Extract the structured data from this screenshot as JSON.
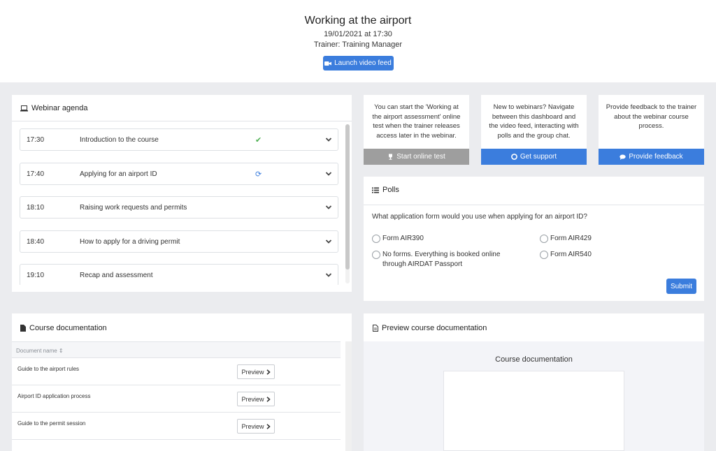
{
  "header": {
    "title": "Working at the airport",
    "date": "19/01/2021 at 17:30",
    "trainer": "Trainer: Training Manager",
    "launch_label": "Launch video feed"
  },
  "agenda": {
    "title": "Webinar agenda",
    "items": [
      {
        "time": "17:30",
        "topic": "Introduction to the course",
        "status": "✔"
      },
      {
        "time": "17:40",
        "topic": "Applying for an airport ID",
        "status": "⟳"
      },
      {
        "time": "18:10",
        "topic": "Raising work requests and permits",
        "status": ""
      },
      {
        "time": "18:40",
        "topic": "How to apply for a driving permit",
        "status": ""
      },
      {
        "time": "19:10",
        "topic": "Recap and assessment",
        "status": ""
      }
    ]
  },
  "info_cards": [
    {
      "text": "You can start the 'Working at the airport assessment' online test when the trainer releases access later in the webinar.",
      "action": "Start online test",
      "icon": "trophy-icon"
    },
    {
      "text": "New to webinars? Navigate between this dashboard and the video feed, interacting with polls and the group chat.",
      "action": "Get support",
      "icon": "lifebuoy-icon"
    },
    {
      "text": "Provide feedback to the trainer about the webinar course process.",
      "action": "Provide feedback",
      "icon": "comment-icon"
    }
  ],
  "polls": {
    "title": "Polls",
    "question": "What application form would you use when applying for an airport ID?",
    "options": [
      "Form AIR390",
      "Form AIR429",
      "No forms. Everything is booked online through AIRDAT Passport",
      "Form AIR540"
    ],
    "submit_label": "Submit"
  },
  "docs": {
    "title": "Course documentation",
    "column": "Document name ⇕",
    "preview_label": "Preview",
    "rows": [
      "Guide to the airport rules",
      "Airport ID application process",
      "Guide to the permit session"
    ]
  },
  "preview": {
    "title": "Preview course documentation",
    "doc_title": "Course documentation"
  },
  "colors": {
    "accent": "#3b7ddd",
    "disabled": "#9e9e9e",
    "check": "#4caf50"
  }
}
